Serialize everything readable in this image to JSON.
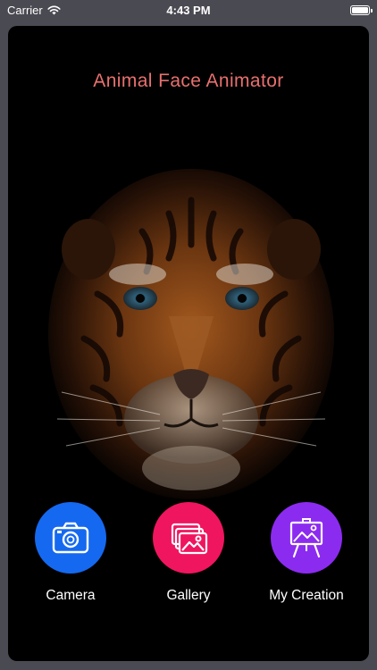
{
  "status_bar": {
    "carrier": "Carrier",
    "time": "4:43 PM",
    "battery_level": 1.0
  },
  "app": {
    "title": "Animal Face Animator",
    "title_color": "#e8706f",
    "background_image": "tiger-face-photo"
  },
  "actions": [
    {
      "label": "Camera",
      "icon": "camera-icon",
      "color": "#1569f0"
    },
    {
      "label": "Gallery",
      "icon": "gallery-icon",
      "color": "#f0155f"
    },
    {
      "label": "My Creation",
      "icon": "easel-icon",
      "color": "#8c2bf0"
    }
  ]
}
